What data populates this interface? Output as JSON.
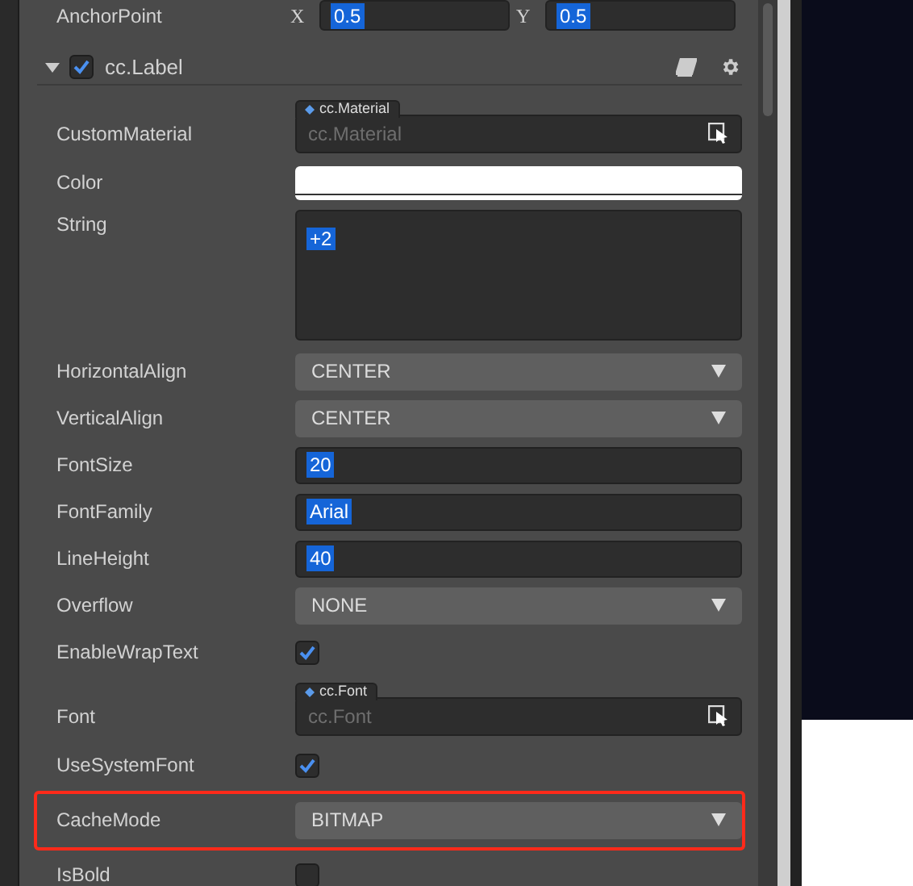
{
  "anchor_point": {
    "label": "AnchorPoint",
    "fields": [
      {
        "axis": "X",
        "value": "0.5"
      },
      {
        "axis": "Y",
        "value": "0.5"
      }
    ]
  },
  "component": {
    "title": "cc.Label",
    "enabled": true,
    "expanded": true
  },
  "properties": [
    {
      "kind": "asset",
      "label": "CustomMaterial",
      "type_tag": "cc.Material",
      "placeholder": "cc.Material",
      "highlighted": false
    },
    {
      "kind": "color",
      "label": "Color",
      "color": "#ffffff",
      "highlighted": false
    },
    {
      "kind": "textarea",
      "label": "String",
      "value": "+2",
      "highlighted": false
    },
    {
      "kind": "select",
      "label": "HorizontalAlign",
      "value": "CENTER",
      "highlighted": false
    },
    {
      "kind": "select",
      "label": "VerticalAlign",
      "value": "CENTER",
      "highlighted": false
    },
    {
      "kind": "input",
      "label": "FontSize",
      "value": "20",
      "highlighted": false
    },
    {
      "kind": "input",
      "label": "FontFamily",
      "value": "Arial",
      "highlighted": false
    },
    {
      "kind": "input",
      "label": "LineHeight",
      "value": "40",
      "highlighted": false
    },
    {
      "kind": "select",
      "label": "Overflow",
      "value": "NONE",
      "highlighted": false
    },
    {
      "kind": "checkbox",
      "label": "EnableWrapText",
      "checked": true,
      "highlighted": false
    },
    {
      "kind": "asset",
      "label": "Font",
      "type_tag": "cc.Font",
      "placeholder": "cc.Font",
      "highlighted": false
    },
    {
      "kind": "checkbox",
      "label": "UseSystemFont",
      "checked": true,
      "highlighted": false
    },
    {
      "kind": "select",
      "label": "CacheMode",
      "value": "BITMAP",
      "highlighted": true
    },
    {
      "kind": "checkbox",
      "label": "IsBold",
      "checked": false,
      "highlighted": false
    }
  ]
}
